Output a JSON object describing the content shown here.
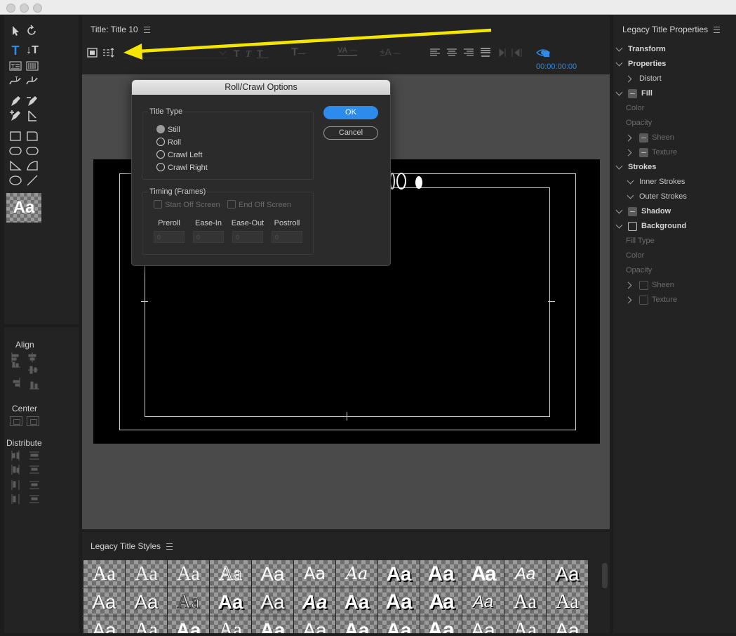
{
  "title_panel": {
    "title": "Title: Title 10",
    "timecode": "00:00:00:00"
  },
  "dialog": {
    "title": "Roll/Crawl Options",
    "title_type_label": "Title Type",
    "options": [
      "Still",
      "Roll",
      "Crawl Left",
      "Crawl Right"
    ],
    "selected": "Still",
    "timing_label": "Timing (Frames)",
    "start_off_screen": "Start Off Screen",
    "end_off_screen": "End Off Screen",
    "fields": [
      "Preroll",
      "Ease-In",
      "Ease-Out",
      "Postroll"
    ],
    "field_values": [
      "0",
      "0",
      "0",
      "0"
    ],
    "ok": "OK",
    "cancel": "Cancel"
  },
  "left_panel": {
    "align": "Align",
    "center": "Center",
    "distribute": "Distribute",
    "style_sample": "Aa"
  },
  "properties": {
    "title": "Legacy Title Properties",
    "transform": "Transform",
    "properties": "Properties",
    "distort": "Distort",
    "fill": "Fill",
    "fill_color": "Color",
    "fill_opacity": "Opacity",
    "fill_sheen": "Sheen",
    "fill_texture": "Texture",
    "strokes": "Strokes",
    "inner_strokes": "Inner Strokes",
    "outer_strokes": "Outer Strokes",
    "shadow": "Shadow",
    "background": "Background",
    "fill_type": "Fill Type",
    "bg_color": "Color",
    "bg_opacity": "Opacity",
    "bg_sheen": "Sheen",
    "bg_texture": "Texture"
  },
  "styles_panel": {
    "title": "Legacy Title Styles",
    "sample": "Aa"
  },
  "colors": {
    "accent": "#2d8ceb",
    "annotation_arrow": "#f5e600"
  }
}
